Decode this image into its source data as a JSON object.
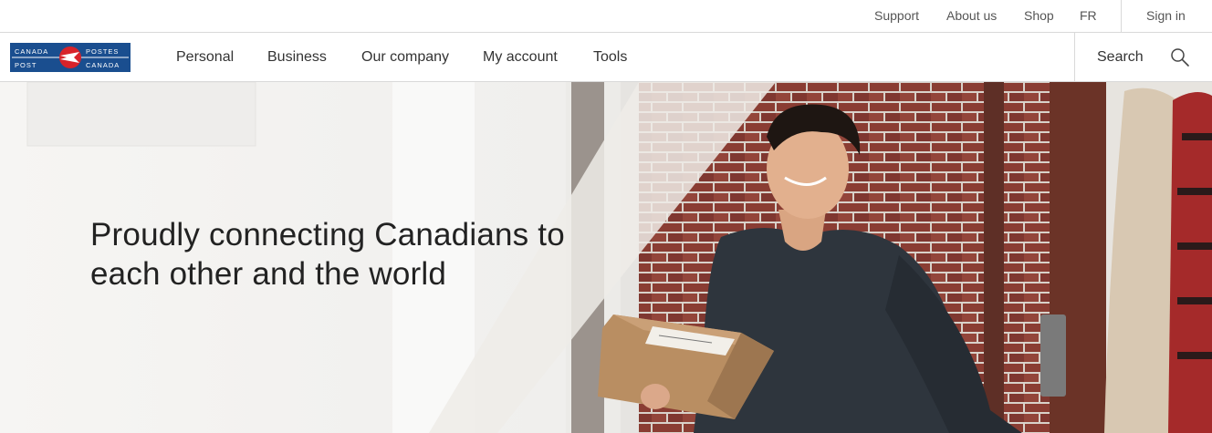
{
  "utility": {
    "support": "Support",
    "about": "About us",
    "shop": "Shop",
    "language": "FR",
    "signin": "Sign in"
  },
  "logo": {
    "line1_left": "CANADA",
    "line1_right": "POSTES",
    "line2_left": "POST",
    "line2_right": "CANADA"
  },
  "nav": {
    "items": [
      {
        "label": "Personal"
      },
      {
        "label": "Business"
      },
      {
        "label": "Our company"
      },
      {
        "label": "My account"
      },
      {
        "label": "Tools"
      }
    ],
    "search_label": "Search"
  },
  "hero": {
    "title": "Proudly connecting Canadians to each other and the world"
  },
  "colors": {
    "brand_blue": "#1a4e8f",
    "brand_red": "#d8232a",
    "brick": "#8a3d33"
  }
}
